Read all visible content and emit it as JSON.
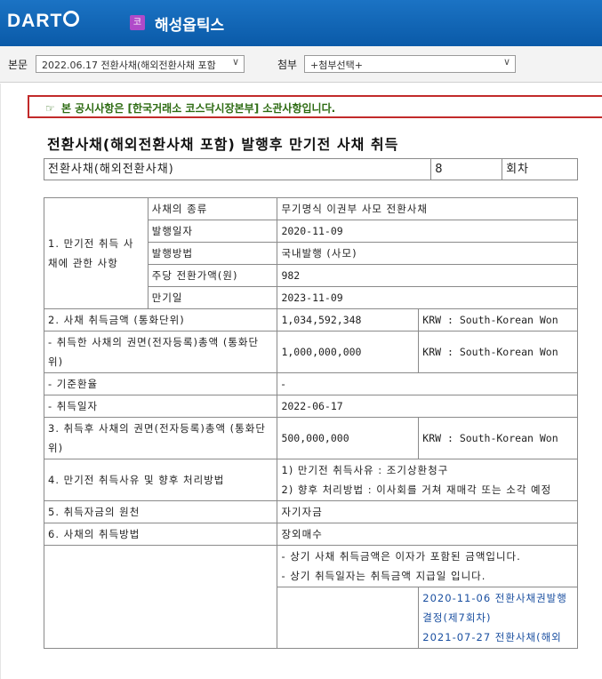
{
  "app": {
    "logo": "DART",
    "corp_badge": "코",
    "corp_name": "해성옵틱스"
  },
  "filter": {
    "main_label": "본문",
    "main_value": "2022.06.17  전환사채(해외전환사채 포함",
    "attach_label": "첨부",
    "attach_value": "+첨부선택+"
  },
  "notice": "본 공시사항은 [한국거래소 코스닥시장본부] 소관사항입니다.",
  "title": "전환사채(해외전환사채 포함) 발행후 만기전 사채 취득",
  "header_row": {
    "type": "전환사채(해외전환사채)",
    "round_no": "8",
    "round_label": "회차"
  },
  "rows": {
    "r1_label": "1. 만기전 취득 사채에 관한 사항",
    "r1_items": [
      {
        "k": "사채의 종류",
        "v": "무기명식 이권부 사모 전환사채"
      },
      {
        "k": "발행일자",
        "v": "2020-11-09"
      },
      {
        "k": "발행방법",
        "v": "국내발행 (사모)"
      },
      {
        "k": "주당 전환가액(원)",
        "v": "982"
      },
      {
        "k": "만기일",
        "v": "2023-11-09"
      }
    ],
    "r2_label": "2. 사채 취득금액 (통화단위)",
    "r2_value": "1,034,592,348",
    "r2_unit": "KRW : South-Korean Won",
    "r2b_label": "- 취득한 사채의 권면(전자등록)총액 (통화단위)",
    "r2b_value": "1,000,000,000",
    "r2b_unit": "KRW : South-Korean Won",
    "r2c_label": "- 기준환율",
    "r2c_value": "-",
    "r2d_label": "- 취득일자",
    "r2d_value": "2022-06-17",
    "r3_label": "3. 취득후 사채의 권면(전자등록)총액 (통화단위)",
    "r3_value": "500,000,000",
    "r3_unit": "KRW : South-Korean Won",
    "r4_label": "4. 만기전 취득사유 및 향후 처리방법",
    "r4_line1": "1) 만기전 취득사유 : 조기상환청구",
    "r4_line2": "2) 향후 처리방법 : 이사회를 거쳐 재매각 또는 소각 예정",
    "r5_label": "5. 취득자금의 원천",
    "r5_value": "자기자금",
    "r6_label": "6. 사채의 취득방법",
    "r6_value": "장외매수",
    "r7_note1": "- 상기 사채 취득금액은 이자가 포함된 금액입니다.",
    "r7_note2": "- 상기 취득일자는 취득금액 지급일 입니다.",
    "r7_link1": "2020-11-06 전환사채권발행결정(제7회차)",
    "r7_link2": "2021-07-27 전환사채(해외"
  }
}
